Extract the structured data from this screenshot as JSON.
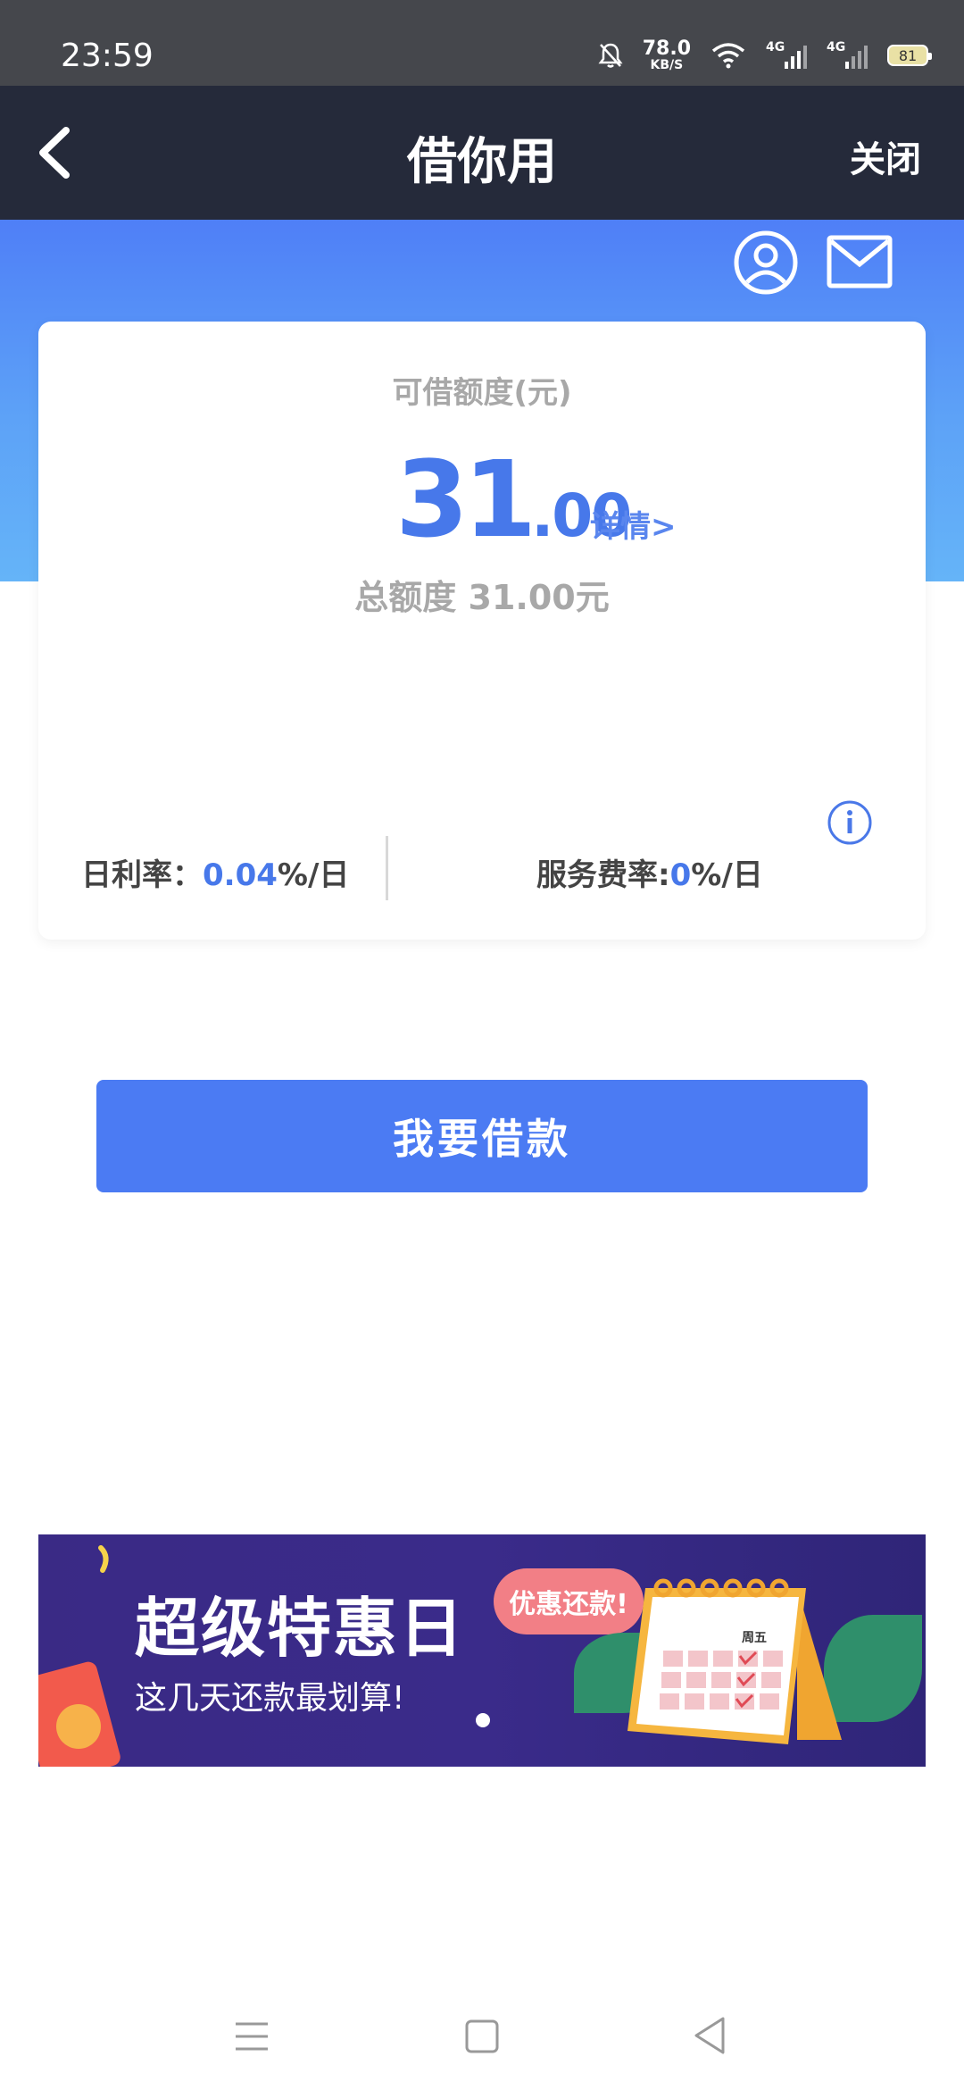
{
  "status_bar": {
    "time": "23:59",
    "net_speed_value": "78.0",
    "net_speed_unit": "KB/S",
    "signal1_label": "4G",
    "signal2_label": "4G",
    "battery": "81"
  },
  "nav": {
    "title": "借你用",
    "close_label": "关闭"
  },
  "card": {
    "label": "可借额度(元)",
    "amount_int": "31",
    "amount_dec": ".00",
    "detail_link": "详情>",
    "total": "总额度 31.00元",
    "daily_rate_label": "日利率：",
    "daily_rate_value": "0.04",
    "daily_rate_unit": "%/日",
    "service_rate_label": "服务费率:",
    "service_rate_value": "0",
    "service_rate_unit": "%/日"
  },
  "borrow_button": "我要借款",
  "banner": {
    "title": "超级特惠日",
    "subtitle": "这几天还款最划算!",
    "tag": "优惠还款!",
    "calendar_label": "周五"
  },
  "colors": {
    "accent": "#4b7bf3",
    "navbar": "#252a3a",
    "statusbar": "#45474c"
  }
}
